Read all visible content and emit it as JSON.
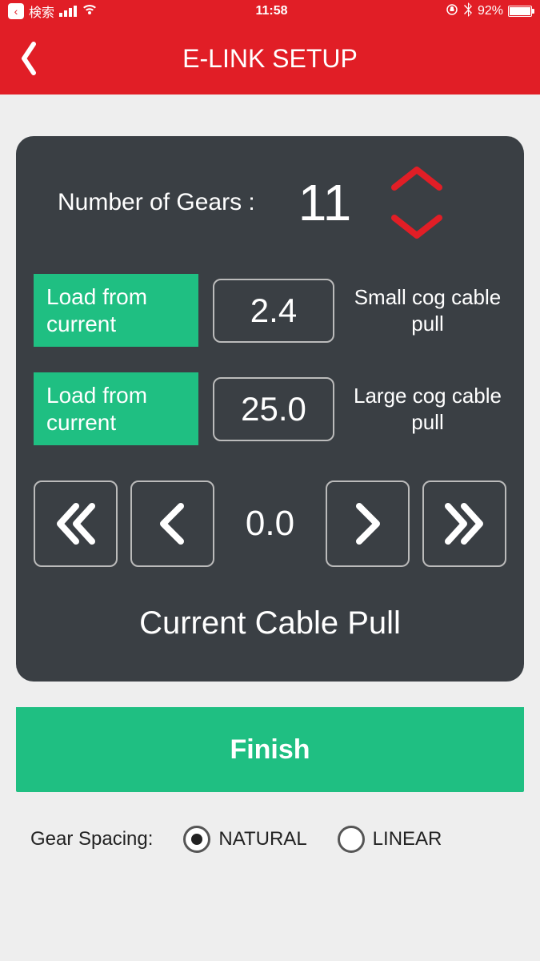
{
  "status": {
    "search_text": "検索",
    "time": "11:58",
    "battery_pct": "92%"
  },
  "header": {
    "title": "E-LINK SETUP"
  },
  "panel": {
    "gears_label": "Number of Gears :",
    "gears_value": "11",
    "small": {
      "load_button": "Load from current",
      "value": "2.4",
      "label": "Small cog cable pull"
    },
    "large": {
      "load_button": "Load from current",
      "value": "25.0",
      "label": "Large cog cable pull"
    },
    "current_value": "0.0",
    "current_label": "Current Cable Pull"
  },
  "finish_label": "Finish",
  "spacing": {
    "label": "Gear Spacing:",
    "natural": "NATURAL",
    "linear": "LINEAR",
    "selected": "natural"
  },
  "colors": {
    "brand": "#e11e26",
    "accent": "#1fbf82",
    "panel": "#3a3f44"
  }
}
